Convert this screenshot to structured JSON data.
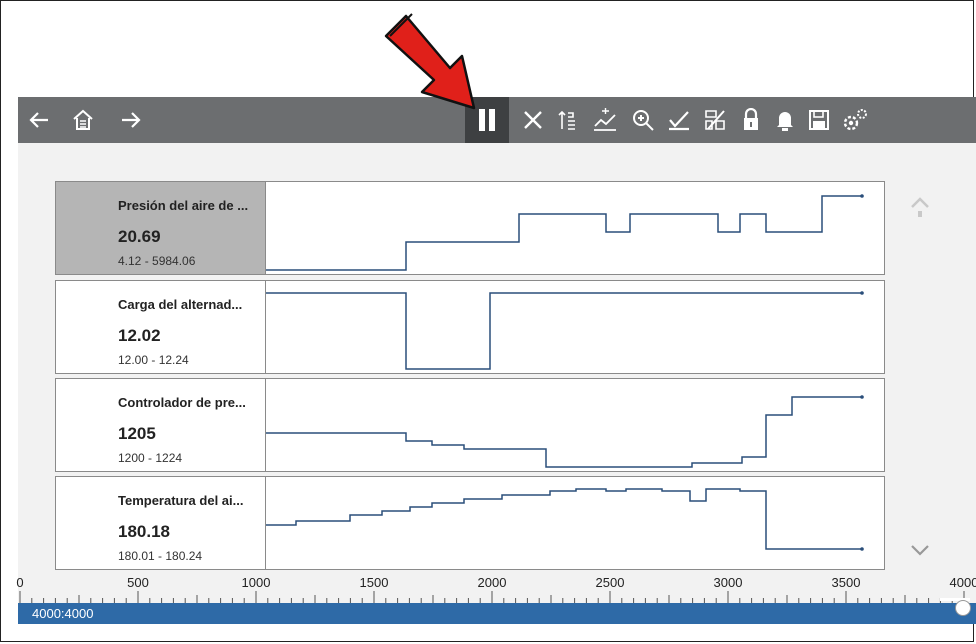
{
  "toolbar": {
    "icons": [
      "back-arrow-icon",
      "home-icon",
      "forward-arrow-icon",
      "pause-icon",
      "close-icon",
      "sort-icon",
      "graph-scale-icon",
      "zoom-icon",
      "check-icon",
      "record-icon",
      "lock-icon",
      "bell-icon",
      "save-icon",
      "settings-icon"
    ]
  },
  "pids": [
    {
      "name": "Presión del aire de ...",
      "value": "20.69",
      "range": "4.12 - 5984.06",
      "selected": true
    },
    {
      "name": "Carga del alternad...",
      "value": "12.02",
      "range": "12.00 - 12.24",
      "selected": false
    },
    {
      "name": "Controlador de pre...",
      "value": "1205",
      "range": "1200 - 1224",
      "selected": false
    },
    {
      "name": "Temperatura del ai...",
      "value": "180.18",
      "range": "180.01 - 180.24",
      "selected": false
    }
  ],
  "ruler": {
    "labels": [
      "0",
      "500",
      "1000",
      "1500",
      "2000",
      "2500",
      "3000",
      "3500",
      "4000"
    ],
    "max": 4000
  },
  "status": {
    "position_text": "4000:4000"
  },
  "colors": {
    "toolbar": "#6c6e70",
    "status_bar": "#2e6aa7",
    "trace": "#2a4e7a",
    "callout_arrow": "#e0201a"
  }
}
